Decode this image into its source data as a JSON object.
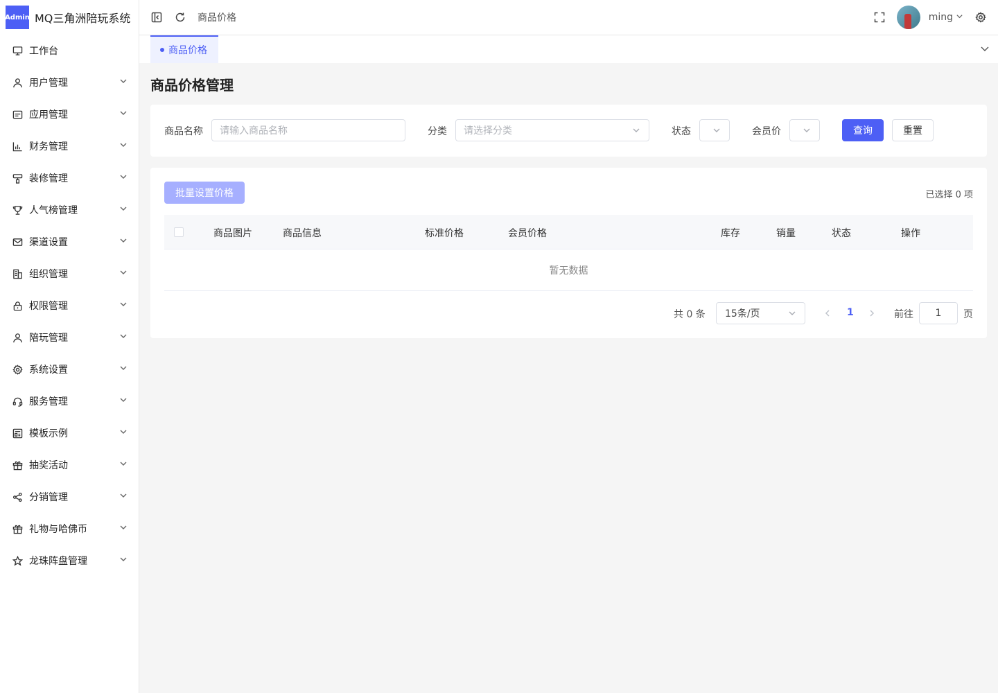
{
  "app": {
    "logo_badge": "Admin",
    "title": "MQ三角洲陪玩系统"
  },
  "sidebar": {
    "items": [
      {
        "label": "工作台",
        "icon": "monitor-icon",
        "has_arrow": false
      },
      {
        "label": "用户管理",
        "icon": "user-icon",
        "has_arrow": true
      },
      {
        "label": "应用管理",
        "icon": "app-window-icon",
        "has_arrow": true
      },
      {
        "label": "财务管理",
        "icon": "bar-chart-icon",
        "has_arrow": true
      },
      {
        "label": "装修管理",
        "icon": "paint-roller-icon",
        "has_arrow": true
      },
      {
        "label": "人气榜管理",
        "icon": "trophy-icon",
        "has_arrow": true
      },
      {
        "label": "渠道设置",
        "icon": "mail-icon",
        "has_arrow": true
      },
      {
        "label": "组织管理",
        "icon": "building-icon",
        "has_arrow": true
      },
      {
        "label": "权限管理",
        "icon": "lock-icon",
        "has_arrow": true
      },
      {
        "label": "陪玩管理",
        "icon": "user-icon",
        "has_arrow": true
      },
      {
        "label": "系统设置",
        "icon": "gear-icon",
        "has_arrow": true
      },
      {
        "label": "服务管理",
        "icon": "headset-icon",
        "has_arrow": true
      },
      {
        "label": "模板示例",
        "icon": "template-icon",
        "has_arrow": true
      },
      {
        "label": "抽奖活动",
        "icon": "gift-icon",
        "has_arrow": true
      },
      {
        "label": "分销管理",
        "icon": "share-icon",
        "has_arrow": true
      },
      {
        "label": "礼物与哈佛币",
        "icon": "gift-icon",
        "has_arrow": true
      },
      {
        "label": "龙珠阵盘管理",
        "icon": "star-icon",
        "has_arrow": true
      }
    ]
  },
  "header": {
    "breadcrumb": "商品价格",
    "username": "ming"
  },
  "tabs": [
    {
      "label": "商品价格",
      "active": true
    }
  ],
  "page": {
    "title": "商品价格管理"
  },
  "filters": {
    "name_label": "商品名称",
    "name_placeholder": "请输入商品名称",
    "category_label": "分类",
    "category_placeholder": "请选择分类",
    "status_label": "状态",
    "member_price_label": "会员价",
    "search_button": "查询",
    "reset_button": "重置"
  },
  "table": {
    "batch_button": "批量设置价格",
    "selected_info": "已选择 0 项",
    "columns": [
      "商品图片",
      "商品信息",
      "标准价格",
      "会员价格",
      "库存",
      "销量",
      "状态",
      "操作"
    ],
    "empty_text": "暂无数据"
  },
  "pagination": {
    "total": "共 0 条",
    "page_size": "15条/页",
    "current_page": "1",
    "goto_label": "前往",
    "goto_value": "1",
    "page_suffix": "页"
  },
  "colors": {
    "primary": "#4d5ff5",
    "primary_disabled": "#a6afff"
  }
}
